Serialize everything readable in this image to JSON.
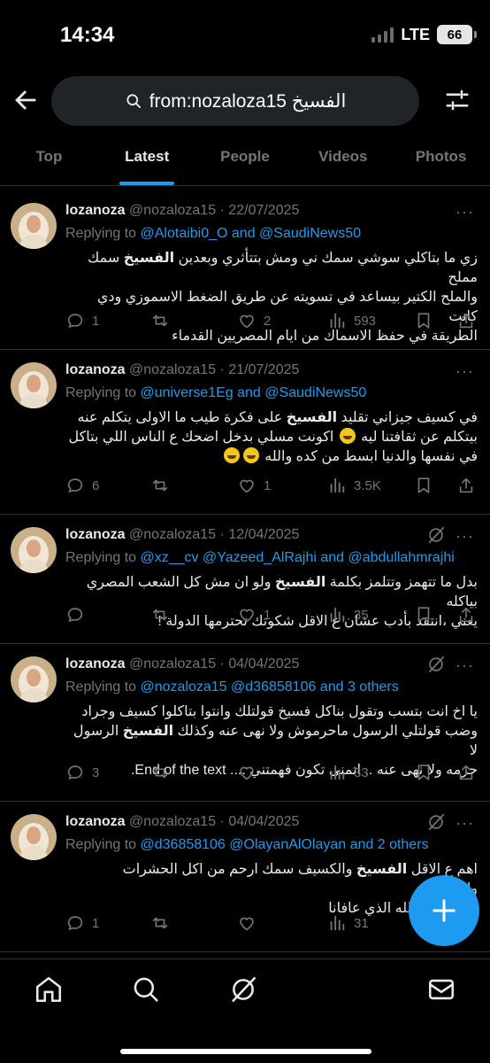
{
  "status": {
    "time": "14:34",
    "network": "LTE",
    "battery": "66"
  },
  "search": {
    "query": "from:nozaloza15 الفسيخ"
  },
  "tabs": [
    "Top",
    "Latest",
    "People",
    "Videos",
    "Photos"
  ],
  "active_tab": "Latest",
  "tweets": [
    {
      "name": "lozanoza",
      "meta": "@nozaloza15 · 22/07/2025",
      "replying_prefix": "Replying to ",
      "replying_to": "@Alotaibi0_O and @SaudiNews50",
      "lines": [
        [
          "زي ما بتاكلي سوشي سمك ني ومش بتتأثري وبعدين ",
          "الفسيخ",
          " سمك مملح"
        ],
        [
          "والملح الكتير بيساعد في تسويته عن طريق الضغط الاسموزي ودي كانت"
        ],
        [
          "الطريقة في حفظ الاسماك من ايام المصريين القدماء"
        ]
      ],
      "replies": "1",
      "reposts": "",
      "likes": "2",
      "views": "593"
    },
    {
      "name": "lozanoza",
      "meta": "@nozaloza15 · 21/07/2025",
      "replying_prefix": "Replying to ",
      "replying_to": "@universe1Eg and @SaudiNews50",
      "lines": [
        [
          "في كسيف جيزاني تقليد ",
          "الفسيخ",
          " على فكرة طيب ما الاولى يتكلم عنه"
        ],
        [
          "بيتكلم عن ثقافتنا ليه ",
          "😂",
          " اكونت مسلي بدخل اضحك ع الناس اللي بتاكل"
        ],
        [
          "في نفسها والدنيا ابسط من كده والله ",
          "😆",
          "😆"
        ]
      ],
      "replies": "6",
      "reposts": "",
      "likes": "1",
      "views": "3.5K"
    },
    {
      "name": "lozanoza",
      "meta": "@nozaloza15 · 12/04/2025",
      "replying_prefix": "Replying to ",
      "replying_to": "@xz__cv @Yazeed_AlRajhi and @abdullahmrajhi",
      "lines": [
        [
          "بدل ما تتهمز وتتلمز بكلمة ",
          "الفسيخ",
          " ولو ان مش كل الشعب المصري بياكله"
        ],
        [
          "يعني ،انتقد بأدب عشان ع الاقل شكوتك تحترمها الدولة !"
        ]
      ],
      "replies": "",
      "reposts": "",
      "likes": "1",
      "views": "35"
    },
    {
      "name": "lozanoza",
      "meta": "@nozaloza15 · 04/04/2025",
      "replying_prefix": "Replying to ",
      "replying_to": "@nozaloza15 @d36858106 and 3 others",
      "lines": [
        [
          "يا اخ انت بتسب وتقول بناكل فسيخ قولتلك وانتوا بتاكلوا كسيف وجراد"
        ],
        [
          "وضب قولتلي الرسول ماحرموش ولا نهى عنه وكذلك ",
          "الفسيخ",
          " الرسول لا"
        ],
        [
          "حرمه ولا نهى عنه .. اتمنى تكون فهمتني .... End of the text."
        ]
      ],
      "replies": "3",
      "reposts": "",
      "likes": "",
      "views": "33"
    },
    {
      "name": "lozanoza",
      "meta": "@nozaloza15 · 04/04/2025",
      "replying_prefix": "Replying to ",
      "replying_to": "@d36858106 @OlayanAlOlayan and 2 others",
      "lines": [
        [
          "اهم ع الاقل ",
          "الفسيخ",
          " والكسيف سمك ارحم من اكل الحشرات والزواحف"
        ],
        [
          "ب... الحمد لله الذي عافانا"
        ]
      ],
      "replies": "1",
      "reposts": "",
      "likes": "",
      "views": "31"
    }
  ],
  "colors": {
    "accent": "#1d9bf0",
    "muted": "#71767b",
    "background": "#000000"
  },
  "icons": [
    "back-arrow-icon",
    "search-icon",
    "filter-icon",
    "more-icon",
    "grok-icon",
    "reply-icon",
    "repost-icon",
    "like-icon",
    "views-icon",
    "bookmark-icon",
    "share-icon",
    "home-icon",
    "explore-icon",
    "grok-nav-icon",
    "messages-icon",
    "compose-icon"
  ]
}
